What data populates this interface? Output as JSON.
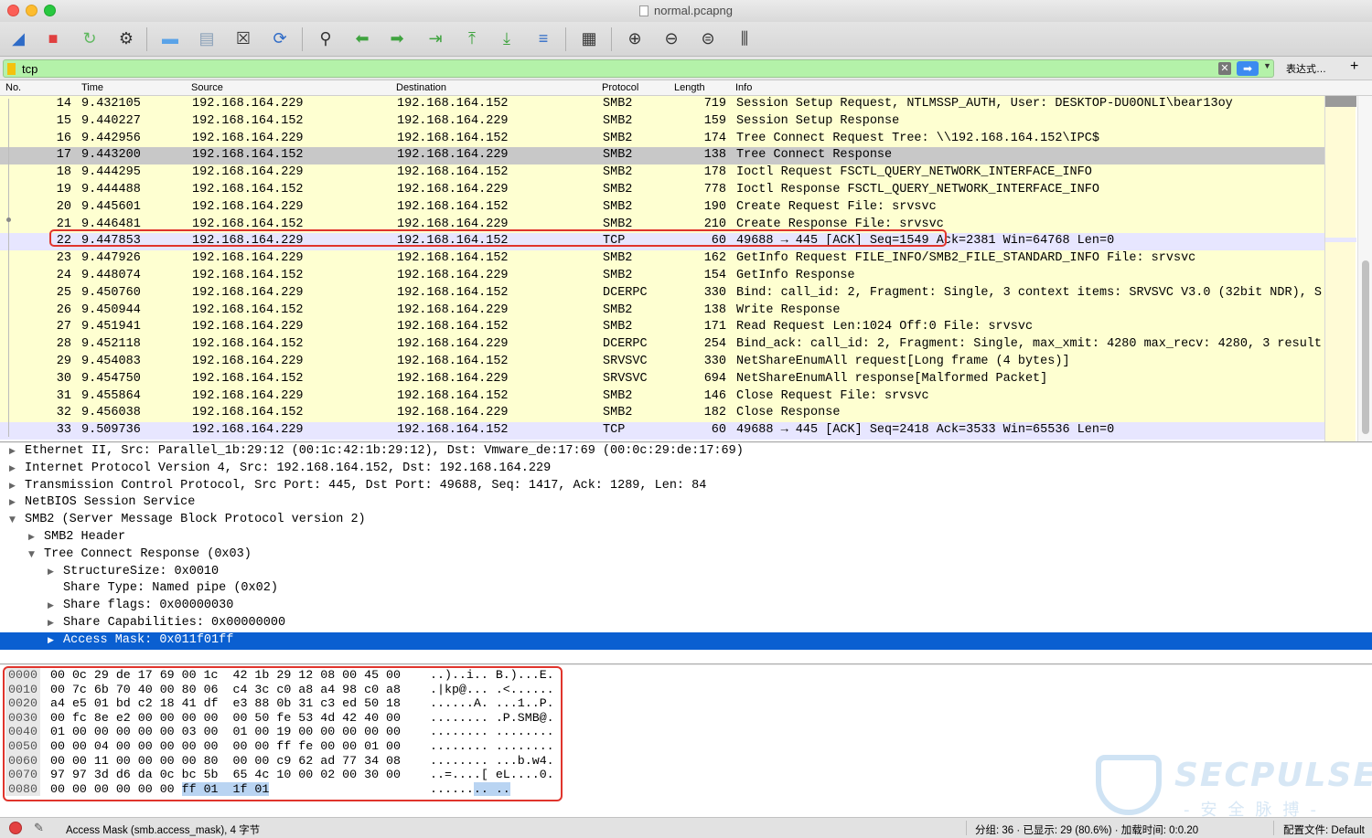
{
  "window": {
    "title": "normal.pcapng"
  },
  "toolbar": {
    "buttons": [
      {
        "name": "start-capture-icon",
        "glyph": "◢",
        "color": "#2e6bc7"
      },
      {
        "name": "stop-capture-icon",
        "glyph": "■",
        "color": "#e04040"
      },
      {
        "name": "restart-capture-icon",
        "glyph": "↻",
        "color": "#5fb85f"
      },
      {
        "name": "capture-options-icon",
        "glyph": "⚙",
        "color": "#333333"
      },
      {
        "name": "open-file-icon",
        "glyph": "▬",
        "color": "#5aa3e8"
      },
      {
        "name": "save-file-icon",
        "glyph": "▤",
        "color": "#8aa0b8"
      },
      {
        "name": "close-file-icon",
        "glyph": "☒",
        "color": "#333333"
      },
      {
        "name": "reload-file-icon",
        "glyph": "⟳",
        "color": "#2e6bc7"
      },
      {
        "name": "find-packet-icon",
        "glyph": "⚲",
        "color": "#333333"
      },
      {
        "name": "go-back-icon",
        "glyph": "⬅",
        "color": "#3fa33f"
      },
      {
        "name": "go-forward-icon",
        "glyph": "➡",
        "color": "#3fa33f"
      },
      {
        "name": "go-to-packet-icon",
        "glyph": "⇥",
        "color": "#3fa33f"
      },
      {
        "name": "first-packet-icon",
        "glyph": "⤒",
        "color": "#3fa33f"
      },
      {
        "name": "last-packet-icon",
        "glyph": "⤓",
        "color": "#3fa33f"
      },
      {
        "name": "autoscroll-icon",
        "glyph": "≡",
        "color": "#2e6bc7"
      },
      {
        "name": "colorize-icon",
        "glyph": "▦",
        "color": "#333333"
      },
      {
        "name": "zoom-in-icon",
        "glyph": "⊕",
        "color": "#333333"
      },
      {
        "name": "zoom-out-icon",
        "glyph": "⊖",
        "color": "#333333"
      },
      {
        "name": "normal-size-icon",
        "glyph": "⊜",
        "color": "#333333"
      },
      {
        "name": "resize-columns-icon",
        "glyph": "⫼",
        "color": "#333333"
      }
    ]
  },
  "filter": {
    "value": "tcp",
    "expression_label": "表达式…",
    "add_label": "+",
    "clear_label": "✕",
    "apply_label": "➡",
    "history_label": "▼"
  },
  "packet_list": {
    "columns": [
      "No.",
      "Time",
      "Source",
      "Destination",
      "Protocol",
      "Length",
      "Info"
    ],
    "rows": [
      {
        "no": "14",
        "time": "9.432105",
        "src": "192.168.164.229",
        "dst": "192.168.164.152",
        "proto": "SMB2",
        "len": "719",
        "info": "Session Setup Request, NTLMSSP_AUTH, User: DESKTOP-DU0ONLI\\bear13oy"
      },
      {
        "no": "15",
        "time": "9.440227",
        "src": "192.168.164.152",
        "dst": "192.168.164.229",
        "proto": "SMB2",
        "len": "159",
        "info": "Session Setup Response"
      },
      {
        "no": "16",
        "time": "9.442956",
        "src": "192.168.164.229",
        "dst": "192.168.164.152",
        "proto": "SMB2",
        "len": "174",
        "info": "Tree Connect Request Tree: \\\\192.168.164.152\\IPC$"
      },
      {
        "no": "17",
        "time": "9.443200",
        "src": "192.168.164.152",
        "dst": "192.168.164.229",
        "proto": "SMB2",
        "len": "138",
        "info": "Tree Connect Response"
      },
      {
        "no": "18",
        "time": "9.444295",
        "src": "192.168.164.229",
        "dst": "192.168.164.152",
        "proto": "SMB2",
        "len": "178",
        "info": "Ioctl Request FSCTL_QUERY_NETWORK_INTERFACE_INFO"
      },
      {
        "no": "19",
        "time": "9.444488",
        "src": "192.168.164.152",
        "dst": "192.168.164.229",
        "proto": "SMB2",
        "len": "778",
        "info": "Ioctl Response FSCTL_QUERY_NETWORK_INTERFACE_INFO"
      },
      {
        "no": "20",
        "time": "9.445601",
        "src": "192.168.164.229",
        "dst": "192.168.164.152",
        "proto": "SMB2",
        "len": "190",
        "info": "Create Request File: srvsvc"
      },
      {
        "no": "21",
        "time": "9.446481",
        "src": "192.168.164.152",
        "dst": "192.168.164.229",
        "proto": "SMB2",
        "len": "210",
        "info": "Create Response File: srvsvc"
      },
      {
        "no": "22",
        "time": "9.447853",
        "src": "192.168.164.229",
        "dst": "192.168.164.152",
        "proto": "TCP",
        "len": "60",
        "info": "49688 → 445 [ACK] Seq=1549 Ack=2381 Win=64768 Len=0"
      },
      {
        "no": "23",
        "time": "9.447926",
        "src": "192.168.164.229",
        "dst": "192.168.164.152",
        "proto": "SMB2",
        "len": "162",
        "info": "GetInfo Request FILE_INFO/SMB2_FILE_STANDARD_INFO File: srvsvc"
      },
      {
        "no": "24",
        "time": "9.448074",
        "src": "192.168.164.152",
        "dst": "192.168.164.229",
        "proto": "SMB2",
        "len": "154",
        "info": "GetInfo Response"
      },
      {
        "no": "25",
        "time": "9.450760",
        "src": "192.168.164.229",
        "dst": "192.168.164.152",
        "proto": "DCERPC",
        "len": "330",
        "info": "Bind: call_id: 2, Fragment: Single, 3 context items: SRVSVC V3.0 (32bit NDR), S"
      },
      {
        "no": "26",
        "time": "9.450944",
        "src": "192.168.164.152",
        "dst": "192.168.164.229",
        "proto": "SMB2",
        "len": "138",
        "info": "Write Response"
      },
      {
        "no": "27",
        "time": "9.451941",
        "src": "192.168.164.229",
        "dst": "192.168.164.152",
        "proto": "SMB2",
        "len": "171",
        "info": "Read Request Len:1024 Off:0 File: srvsvc"
      },
      {
        "no": "28",
        "time": "9.452118",
        "src": "192.168.164.152",
        "dst": "192.168.164.229",
        "proto": "DCERPC",
        "len": "254",
        "info": "Bind_ack: call_id: 2, Fragment: Single, max_xmit: 4280 max_recv: 4280, 3 result"
      },
      {
        "no": "29",
        "time": "9.454083",
        "src": "192.168.164.229",
        "dst": "192.168.164.152",
        "proto": "SRVSVC",
        "len": "330",
        "info": "NetShareEnumAll request[Long frame (4 bytes)]"
      },
      {
        "no": "30",
        "time": "9.454750",
        "src": "192.168.164.152",
        "dst": "192.168.164.229",
        "proto": "SRVSVC",
        "len": "694",
        "info": "NetShareEnumAll response[Malformed Packet]"
      },
      {
        "no": "31",
        "time": "9.455864",
        "src": "192.168.164.229",
        "dst": "192.168.164.152",
        "proto": "SMB2",
        "len": "146",
        "info": "Close Request File: srvsvc"
      },
      {
        "no": "32",
        "time": "9.456038",
        "src": "192.168.164.152",
        "dst": "192.168.164.229",
        "proto": "SMB2",
        "len": "182",
        "info": "Close Response"
      },
      {
        "no": "33",
        "time": "9.509736",
        "src": "192.168.164.229",
        "dst": "192.168.164.152",
        "proto": "TCP",
        "len": "60",
        "info": "49688 → 445 [ACK] Seq=2418 Ack=3533 Win=65536 Len=0"
      }
    ],
    "selected_no": "17"
  },
  "details": {
    "rows": [
      {
        "depth": 0,
        "toggle": "▶",
        "text": "Ethernet II, Src: Parallel_1b:29:12 (00:1c:42:1b:29:12), Dst: Vmware_de:17:69 (00:0c:29:de:17:69)"
      },
      {
        "depth": 0,
        "toggle": "▶",
        "text": "Internet Protocol Version 4, Src: 192.168.164.152, Dst: 192.168.164.229"
      },
      {
        "depth": 0,
        "toggle": "▶",
        "text": "Transmission Control Protocol, Src Port: 445, Dst Port: 49688, Seq: 1417, Ack: 1289, Len: 84"
      },
      {
        "depth": 0,
        "toggle": "▶",
        "text": "NetBIOS Session Service"
      },
      {
        "depth": 0,
        "toggle": "▼",
        "text": "SMB2 (Server Message Block Protocol version 2)"
      },
      {
        "depth": 1,
        "toggle": "▶",
        "text": "SMB2 Header"
      },
      {
        "depth": 1,
        "toggle": "▼",
        "text": "Tree Connect Response (0x03)"
      },
      {
        "depth": 2,
        "toggle": "▶",
        "text": "StructureSize: 0x0010"
      },
      {
        "depth": 2,
        "toggle": "",
        "text": "Share Type: Named pipe (0x02)"
      },
      {
        "depth": 2,
        "toggle": "▶",
        "text": "Share flags: 0x00000030"
      },
      {
        "depth": 2,
        "toggle": "▶",
        "text": "Share Capabilities: 0x00000000"
      },
      {
        "depth": 2,
        "toggle": "▶",
        "text": "Access Mask: 0x011f01ff"
      }
    ],
    "selected_index": 11
  },
  "bytes": {
    "rows": [
      {
        "offset": "0000",
        "hex": "00 0c 29 de 17 69 00 1c  42 1b 29 12 08 00 45 00",
        "hex_hl": "",
        "ascii": "..)..i.. B.)...E.",
        "ascii_hl": ""
      },
      {
        "offset": "0010",
        "hex": "00 7c 6b 70 40 00 80 06  c4 3c c0 a8 a4 98 c0 a8",
        "hex_hl": "",
        "ascii": ".|kp@... .<......",
        "ascii_hl": ""
      },
      {
        "offset": "0020",
        "hex": "a4 e5 01 bd c2 18 41 df  e3 88 0b 31 c3 ed 50 18",
        "hex_hl": "",
        "ascii": "......A. ...1..P.",
        "ascii_hl": ""
      },
      {
        "offset": "0030",
        "hex": "00 fc 8e e2 00 00 00 00  00 50 fe 53 4d 42 40 00",
        "hex_hl": "",
        "ascii": "........ .P.SMB@.",
        "ascii_hl": ""
      },
      {
        "offset": "0040",
        "hex": "01 00 00 00 00 00 03 00  01 00 19 00 00 00 00 00",
        "hex_hl": "",
        "ascii": "........ ........",
        "ascii_hl": ""
      },
      {
        "offset": "0050",
        "hex": "00 00 04 00 00 00 00 00  00 00 ff fe 00 00 01 00",
        "hex_hl": "",
        "ascii": "........ ........",
        "ascii_hl": ""
      },
      {
        "offset": "0060",
        "hex": "00 00 11 00 00 00 00 80  00 00 c9 62 ad 77 34 08",
        "hex_hl": "",
        "ascii": "........ ...b.w4.",
        "ascii_hl": ""
      },
      {
        "offset": "0070",
        "hex": "97 97 3d d6 da 0c bc 5b  65 4c 10 00 02 00 30 00",
        "hex_hl": "",
        "ascii": "..=....[ eL....0.",
        "ascii_hl": ""
      },
      {
        "offset": "0080",
        "hex": "00 00 00 00 00 00 ",
        "hex_hl": "ff 01  1f 01",
        "ascii": "......",
        "ascii_hl": ".. .."
      }
    ],
    "watermark": {
      "brand": "SECPULSE",
      "tagline": "-安全脉搏-"
    }
  },
  "status": {
    "field": "Access Mask (smb.access_mask), 4 字节",
    "stats": "分组: 36 · 已显示: 29 (80.6%) · 加载时间: 0:0.20",
    "profile": "配置文件: Default",
    "edit_icon": "✎"
  },
  "colors": {
    "smb_row": "#feffd1",
    "tcp_row": "#e7e6ff",
    "selected_row": "#c8c8c8",
    "selected_detail": "#0a5fd1",
    "filter_ok": "#b4f2a9",
    "annotation_red": "#e0342c"
  }
}
